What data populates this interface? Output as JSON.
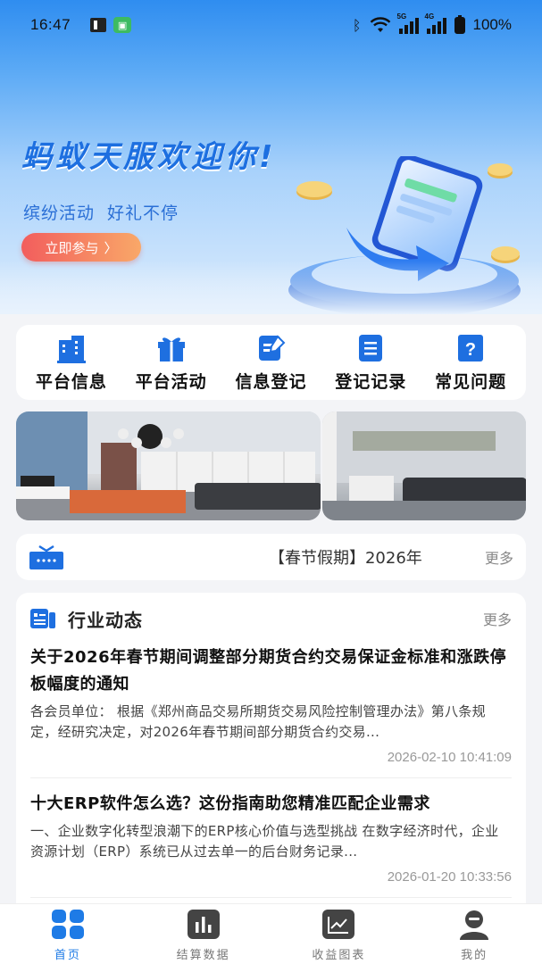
{
  "status_bar": {
    "time": "16:47",
    "battery": "100%",
    "network_5g": "5G",
    "network_4g": "4G"
  },
  "banner": {
    "title": "蚂蚁天服欢迎你!",
    "subtitle_a": "缤纷活动",
    "subtitle_b": "好礼不停",
    "cta": "立即参与"
  },
  "quick_menu": [
    {
      "label": "平台信息",
      "icon": "building-icon"
    },
    {
      "label": "平台活动",
      "icon": "gift-icon"
    },
    {
      "label": "信息登记",
      "icon": "edit-doc-icon"
    },
    {
      "label": "登记记录",
      "icon": "list-icon"
    },
    {
      "label": "常见问题",
      "icon": "question-icon"
    }
  ],
  "notice": {
    "text": "【春节假期】2026年",
    "more": "更多"
  },
  "news": {
    "title": "行业动态",
    "more": "更多",
    "articles": [
      {
        "title": "关于2026年春节期间调整部分期货合约交易保证金标准和涨跌停板幅度的通知",
        "summary": "各会员单位：  根据《郑州商品交易所期货交易风险控制管理办法》第八条规定，经研究决定，对2026年春节期间部分期货合约交易...",
        "time": "2026-02-10 10:41:09"
      },
      {
        "title": "十大ERP软件怎么选？这份指南助您精准匹配企业需求",
        "summary": "一、企业数字化转型浪潮下的ERP核心价值与选型挑战 在数字经济时代，企业资源计划（ERP）系统已从过去单一的后台财务记录...",
        "time": "2026-01-20 10:33:56"
      }
    ]
  },
  "bottom_nav": [
    {
      "label": "首页",
      "icon": "home-grid-icon",
      "active": true
    },
    {
      "label": "结算数据",
      "icon": "bar-chart-icon",
      "active": false
    },
    {
      "label": "收益图表",
      "icon": "line-chart-icon",
      "active": false
    },
    {
      "label": "我的",
      "icon": "user-icon",
      "active": false
    }
  ],
  "colors": {
    "brand_blue": "#1e7be6",
    "cta_red": "#f25d5d",
    "cta_orange": "#f9a868"
  }
}
